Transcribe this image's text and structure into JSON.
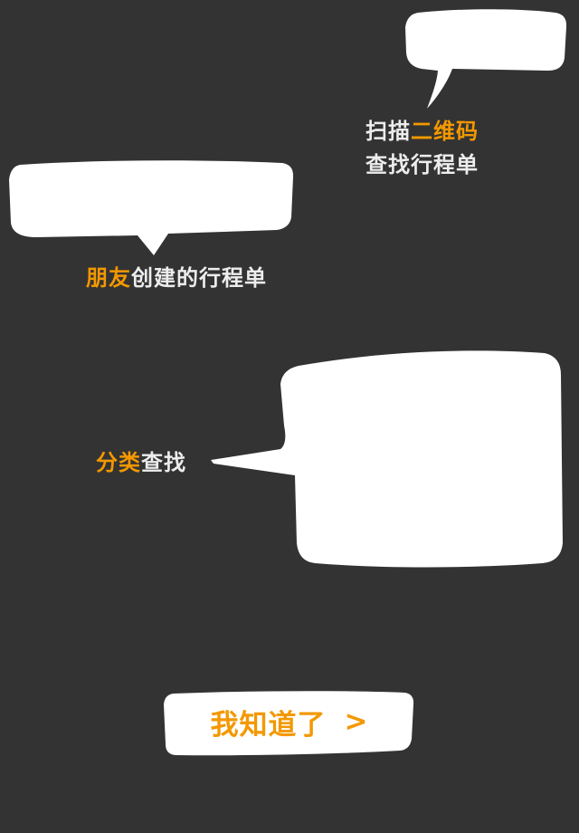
{
  "guide": {
    "qr_hint": {
      "highlight": "二维码",
      "prefix": "扫描",
      "line2": "查找行程单"
    },
    "friend_hint": {
      "highlight": "朋友",
      "rest": "创建的行程单"
    },
    "category_hint": {
      "highlight": "分类",
      "rest": "查找"
    },
    "dismiss_button": {
      "label": "我知道了",
      "chevron": ">"
    }
  },
  "colors": {
    "background": "#333333",
    "highlight": "#f39800",
    "text": "#ededed",
    "bubble": "#ffffff"
  }
}
